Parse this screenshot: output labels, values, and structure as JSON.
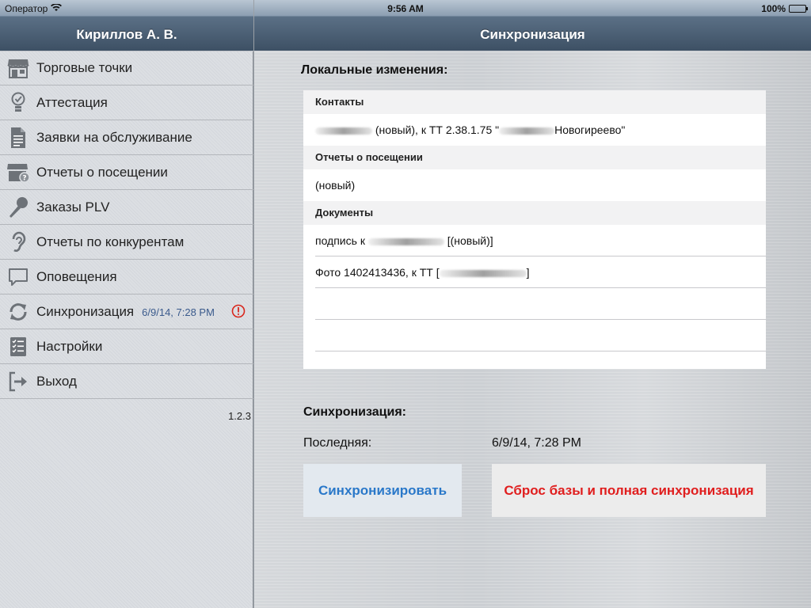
{
  "status_bar": {
    "carrier": "Оператор",
    "time": "9:56 AM",
    "battery": "100%"
  },
  "sidebar": {
    "title": "Кириллов А. В.",
    "items": [
      {
        "label": "Торговые точки",
        "icon": "store-icon"
      },
      {
        "label": "Аттестация",
        "icon": "lightbulb-icon"
      },
      {
        "label": "Заявки на обслуживание",
        "icon": "document-icon"
      },
      {
        "label": "Отчеты о посещении",
        "icon": "store-report-icon"
      },
      {
        "label": "Заказы PLV",
        "icon": "microphone-icon"
      },
      {
        "label": "Отчеты по конкурентам",
        "icon": "ear-icon"
      },
      {
        "label": "Оповещения",
        "icon": "speech-bubble-icon"
      },
      {
        "label": "Синхронизация",
        "sublabel": "6/9/14, 7:28 PM",
        "icon": "sync-icon",
        "alert_icon": "exclamation-circle-icon"
      },
      {
        "label": "Настройки",
        "icon": "checklist-icon"
      },
      {
        "label": "Выход",
        "icon": "logout-icon"
      }
    ],
    "version": "1.2.3"
  },
  "main": {
    "title": "Синхронизация",
    "local_changes_title": "Локальные изменения:",
    "table": {
      "sections": [
        {
          "header": "Контакты",
          "rows": [
            {
              "before": "",
              "text": "(новый), к ТТ 2.38.1.75 \"",
              "after": "Новогиреево\""
            }
          ]
        },
        {
          "header": "Отчеты о посещении",
          "rows": [
            {
              "text": "(новый)"
            }
          ]
        },
        {
          "header": "Документы",
          "rows": [
            {
              "text": "подпись к",
              "after": "[(новый)]"
            },
            {
              "text": "Фото 1402413436, к ТТ [",
              "after": "]"
            }
          ]
        }
      ]
    },
    "sync_section_title": "Синхронизация:",
    "last_label": "Последняя:",
    "last_value": "6/9/14, 7:28 PM",
    "sync_button": "Синхронизировать",
    "reset_button": "Сброс базы и полная синхронизация"
  },
  "colors": {
    "header_dark": "#3d5064",
    "sync_button_text": "#2a78c9",
    "reset_button_text": "#e01e1e",
    "alert": "#d9261c",
    "timestamp_blue": "#3a5a8c"
  }
}
